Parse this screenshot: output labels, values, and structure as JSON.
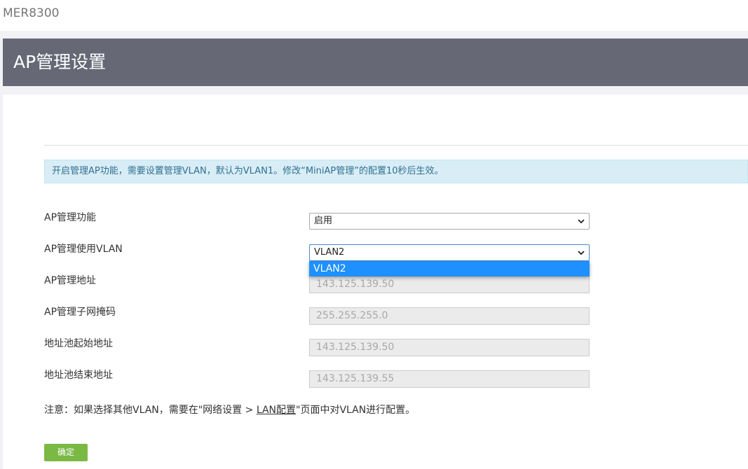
{
  "header": {
    "brand": "MER8300",
    "page_title": "AP管理设置"
  },
  "info": {
    "message": "开启管理AP功能，需要设置管理VLAN，默认为VLAN1。修改“MiniAP管理”的配置10秒后生效。"
  },
  "form": {
    "ap_manage_function": {
      "label": "AP管理功能",
      "value": "启用"
    },
    "ap_manage_vlan": {
      "label": "AP管理使用VLAN",
      "value": "VLAN2",
      "open_options": [
        "VLAN2"
      ]
    },
    "ap_manage_address": {
      "label": "AP管理地址",
      "value": "143.125.139.50"
    },
    "ap_manage_subnet_mask": {
      "label": "AP管理子网掩码",
      "value": "255.255.255.0"
    },
    "pool_start_address": {
      "label": "地址池起始地址",
      "value": "143.125.139.50"
    },
    "pool_end_address": {
      "label": "地址池结束地址",
      "value": "143.125.139.55"
    }
  },
  "note": {
    "prefix": "注意：如果选择其他VLAN，需要在\"网络设置 > ",
    "link": "LAN配置",
    "suffix": "\"页面中对VLAN进行配置。"
  },
  "actions": {
    "confirm_label": "确定"
  },
  "colors": {
    "title_bar": "#666875",
    "info_background": "#d9edf7",
    "info_text": "#31708f",
    "highlight_option": "#1e90ff",
    "confirm_button": "#7bb945"
  }
}
